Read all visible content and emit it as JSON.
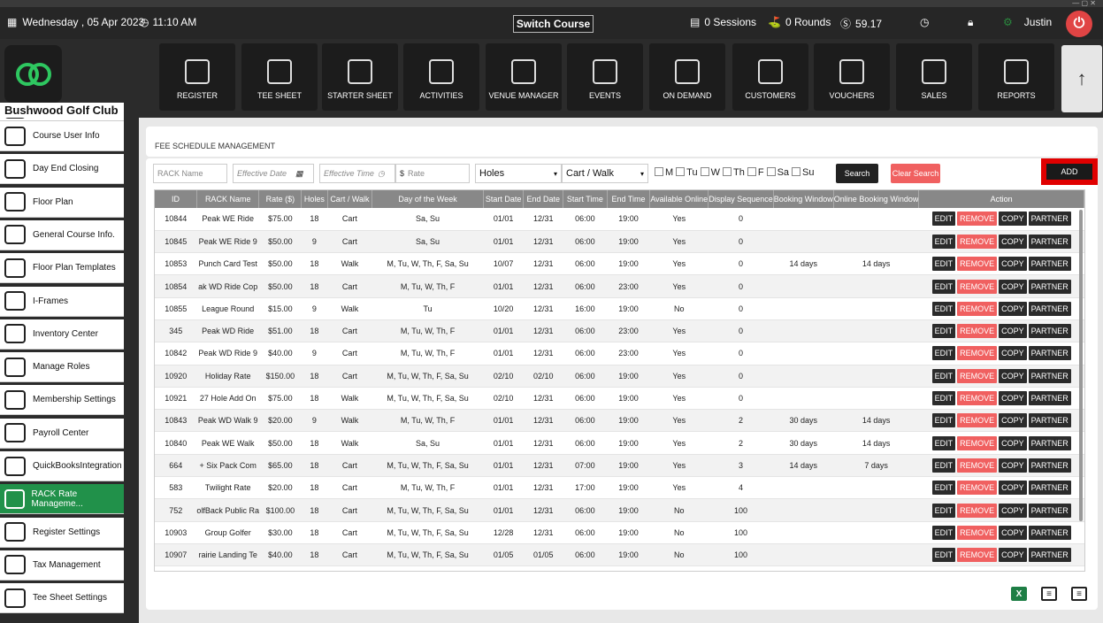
{
  "topbar": {
    "date": "Wednesday , 05 Apr 2023",
    "time": "11:10 AM",
    "switch_course": "Switch Course",
    "sessions": "0 Sessions",
    "rounds": "0 Rounds",
    "balance": "59.17",
    "user": "Justin"
  },
  "club_name": "Bushwood Golf Club",
  "nav_tiles": [
    "REGISTER",
    "TEE SHEET",
    "STARTER SHEET",
    "ACTIVITIES",
    "VENUE MANAGER",
    "EVENTS",
    "ON DEMAND",
    "CUSTOMERS",
    "VOUCHERS",
    "SALES",
    "REPORTS"
  ],
  "sidebar": [
    {
      "label": "Course User Info",
      "icon": "user-icon"
    },
    {
      "label": "Day End Closing",
      "icon": "cash-register-icon"
    },
    {
      "label": "Floor Plan",
      "icon": "floor-plan-icon"
    },
    {
      "label": "General Course Info.",
      "icon": "home-icon"
    },
    {
      "label": "Floor Plan Templates",
      "icon": "floor-plan-icon"
    },
    {
      "label": "I-Frames",
      "icon": "code-icon"
    },
    {
      "label": "Inventory Center",
      "icon": "inventory-icon"
    },
    {
      "label": "Manage Roles",
      "icon": "roles-icon"
    },
    {
      "label": "Membership Settings",
      "icon": "gear-icon"
    },
    {
      "label": "Payroll Center",
      "icon": "clock-icon"
    },
    {
      "label": "QuickBooksIntegration",
      "icon": "quickbooks-icon"
    },
    {
      "label": "RACK Rate Manageme...",
      "icon": "dollar-icon",
      "active": true
    },
    {
      "label": "Register Settings",
      "icon": "register-icon"
    },
    {
      "label": "Tax Management",
      "icon": "tax-icon"
    },
    {
      "label": "Tee Sheet Settings",
      "icon": "tee-icon"
    }
  ],
  "breadcrumb": "FEE SCHEDULE MANAGEMENT",
  "filters": {
    "rack_name_placeholder": "RACK Name",
    "effective_date_placeholder": "Effective Date",
    "effective_time_placeholder": "Effective Time",
    "rate_placeholder": "Rate",
    "holes": "Holes",
    "cart_walk": "Cart / Walk",
    "days": [
      "M",
      "Tu",
      "W",
      "Th",
      "F",
      "Sa",
      "Su"
    ],
    "search": "Search",
    "clear_search": "Clear Search",
    "add": "ADD"
  },
  "table": {
    "columns": [
      "ID",
      "RACK Name",
      "Rate ($)",
      "Holes",
      "Cart / Walk",
      "Day of the Week",
      "Start Date",
      "End Date",
      "Start Time",
      "End Time",
      "Available Online",
      "Display Sequence",
      "Booking Window",
      "Online Booking Window",
      "Action"
    ],
    "actions": [
      "EDIT",
      "REMOVE",
      "COPY",
      "PARTNER"
    ],
    "rows": [
      [
        "10844",
        "Peak WE Ride",
        "$75.00",
        "18",
        "Cart",
        "Sa, Su",
        "01/01",
        "12/31",
        "06:00",
        "19:00",
        "Yes",
        "0",
        "",
        ""
      ],
      [
        "10845",
        "Peak WE Ride 9",
        "$50.00",
        "9",
        "Cart",
        "Sa, Su",
        "01/01",
        "12/31",
        "06:00",
        "19:00",
        "Yes",
        "0",
        "",
        ""
      ],
      [
        "10853",
        "Punch Card Test",
        "$50.00",
        "18",
        "Walk",
        "M, Tu, W, Th, F, Sa, Su",
        "10/07",
        "12/31",
        "06:00",
        "19:00",
        "Yes",
        "0",
        "14 days",
        "14 days"
      ],
      [
        "10854",
        "ak WD Ride Cop",
        "$50.00",
        "18",
        "Cart",
        "M, Tu, W, Th, F",
        "01/01",
        "12/31",
        "06:00",
        "23:00",
        "Yes",
        "0",
        "",
        ""
      ],
      [
        "10855",
        "League Round",
        "$15.00",
        "9",
        "Walk",
        "Tu",
        "10/20",
        "12/31",
        "16:00",
        "19:00",
        "No",
        "0",
        "",
        ""
      ],
      [
        "345",
        "Peak WD Ride",
        "$51.00",
        "18",
        "Cart",
        "M, Tu, W, Th, F",
        "01/01",
        "12/31",
        "06:00",
        "23:00",
        "Yes",
        "0",
        "",
        ""
      ],
      [
        "10842",
        "Peak WD Ride 9",
        "$40.00",
        "9",
        "Cart",
        "M, Tu, W, Th, F",
        "01/01",
        "12/31",
        "06:00",
        "23:00",
        "Yes",
        "0",
        "",
        ""
      ],
      [
        "10920",
        "Holiday Rate",
        "$150.00",
        "18",
        "Cart",
        "M, Tu, W, Th, F, Sa, Su",
        "02/10",
        "02/10",
        "06:00",
        "19:00",
        "Yes",
        "0",
        "",
        ""
      ],
      [
        "10921",
        "27 Hole Add On",
        "$75.00",
        "18",
        "Walk",
        "M, Tu, W, Th, F, Sa, Su",
        "02/10",
        "12/31",
        "06:00",
        "19:00",
        "Yes",
        "0",
        "",
        ""
      ],
      [
        "10843",
        "Peak WD Walk 9",
        "$20.00",
        "9",
        "Walk",
        "M, Tu, W, Th, F",
        "01/01",
        "12/31",
        "06:00",
        "19:00",
        "Yes",
        "2",
        "30 days",
        "14 days"
      ],
      [
        "10840",
        "Peak WE Walk",
        "$50.00",
        "18",
        "Walk",
        "Sa, Su",
        "01/01",
        "12/31",
        "06:00",
        "19:00",
        "Yes",
        "2",
        "30 days",
        "14 days"
      ],
      [
        "664",
        "+ Six Pack Com",
        "$65.00",
        "18",
        "Cart",
        "M, Tu, W, Th, F, Sa, Su",
        "01/01",
        "12/31",
        "07:00",
        "19:00",
        "Yes",
        "3",
        "14 days",
        "7 days"
      ],
      [
        "583",
        "Twilight Rate",
        "$20.00",
        "18",
        "Cart",
        "M, Tu, W, Th, F",
        "01/01",
        "12/31",
        "17:00",
        "19:00",
        "Yes",
        "4",
        "",
        ""
      ],
      [
        "752",
        "olfBack Public Ra",
        "$100.00",
        "18",
        "Cart",
        "M, Tu, W, Th, F, Sa, Su",
        "01/01",
        "12/31",
        "06:00",
        "19:00",
        "No",
        "100",
        "",
        ""
      ],
      [
        "10903",
        "Group Golfer",
        "$30.00",
        "18",
        "Cart",
        "M, Tu, W, Th, F, Sa, Su",
        "12/28",
        "12/31",
        "06:00",
        "19:00",
        "No",
        "100",
        "",
        ""
      ],
      [
        "10907",
        "rairie Landing Te",
        "$40.00",
        "18",
        "Cart",
        "M, Tu, W, Th, F, Sa, Su",
        "01/05",
        "01/05",
        "06:00",
        "19:00",
        "No",
        "100",
        "",
        ""
      ]
    ]
  },
  "colors": {
    "accent_green": "#21914a",
    "remove_red": "#f06060",
    "highlight_red": "#e00000",
    "dark": "#262626"
  }
}
